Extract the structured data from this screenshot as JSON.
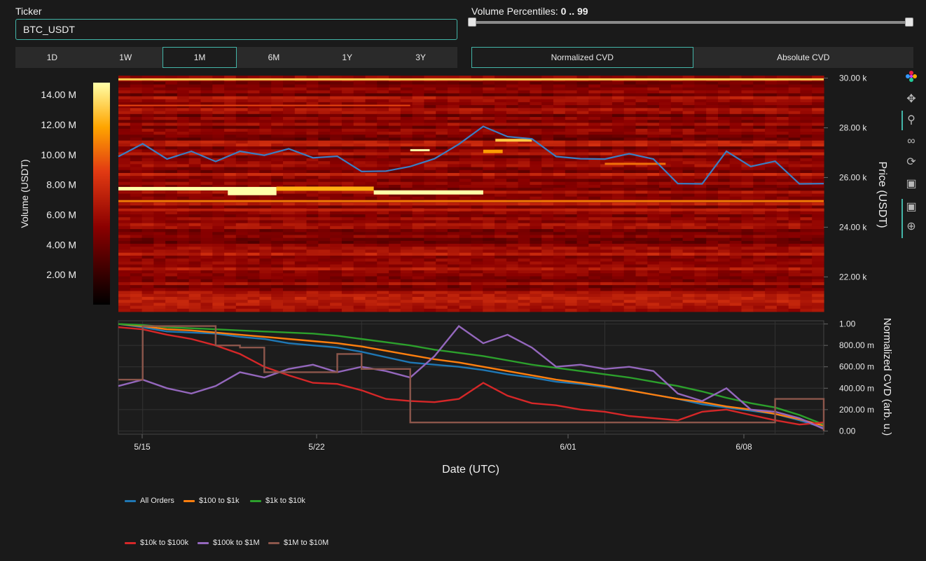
{
  "ticker": {
    "label": "Ticker",
    "value": "BTC_USDT"
  },
  "volume_percentiles": {
    "label": "Volume Percentiles:",
    "range_text": "0 .. 99",
    "min": 0,
    "max": 99
  },
  "range_buttons": [
    {
      "label": "1D",
      "active": false
    },
    {
      "label": "1W",
      "active": false
    },
    {
      "label": "1M",
      "active": true
    },
    {
      "label": "6M",
      "active": false
    },
    {
      "label": "1Y",
      "active": false
    },
    {
      "label": "3Y",
      "active": false
    }
  ],
  "cvd_buttons": [
    {
      "label": "Normalized CVD",
      "active": true
    },
    {
      "label": "Absolute CVD",
      "active": false
    }
  ],
  "modebar_icons": [
    "plotly-logo-icon",
    "pan-icon",
    "zoom-icon",
    "lasso-icon",
    "reset-icon",
    "download-icon",
    "comment-icon",
    "crosshair-icon"
  ],
  "chart_data": [
    {
      "type": "heatmap",
      "xlabel": "",
      "ylabel": "Price (USDT)",
      "y_ticks": [
        "22.00 k",
        "24.00 k",
        "26.00 k",
        "28.00 k",
        "30.00 k"
      ],
      "y_tick_values": [
        22000,
        24000,
        26000,
        28000,
        30000
      ],
      "ylim": [
        20600,
        30100
      ],
      "colorbar": {
        "label": "Volume (USDT)",
        "ticks": [
          "2.00 M",
          "4.00 M",
          "6.00 M",
          "8.00 M",
          "10.00 M",
          "12.00 M",
          "14.00 M"
        ],
        "range": [
          0,
          14800000
        ]
      },
      "price_line": {
        "name": "Price",
        "x_days": [
          0,
          1,
          2,
          3,
          4,
          5,
          6,
          7,
          8,
          9,
          10,
          11,
          12,
          13,
          14,
          15,
          16,
          17,
          18,
          19,
          20,
          21,
          22,
          23,
          24,
          25,
          26,
          27,
          28,
          29
        ],
        "values": [
          26900,
          27300,
          26800,
          27000,
          26700,
          27000,
          26950,
          27100,
          26850,
          26800,
          26300,
          26200,
          26500,
          26700,
          27400,
          28000,
          27700,
          27500,
          26900,
          26700,
          26800,
          26900,
          26800,
          25700,
          25800,
          27000,
          26500,
          26600,
          25800,
          25700
        ]
      }
    },
    {
      "type": "line",
      "xlabel": "Date (UTC)",
      "ylabel": "Normalized CVD (arb. u.)",
      "x_ticks": [
        "5/15",
        "5/22",
        "6/01",
        "6/08"
      ],
      "y_ticks": [
        "0.00",
        "200.00 m",
        "400.00 m",
        "600.00 m",
        "800.00 m",
        "1.00"
      ],
      "y_tick_values": [
        0,
        0.2,
        0.4,
        0.6,
        0.8,
        1.0
      ],
      "ylim": [
        -0.03,
        1.03
      ],
      "x_days": [
        0,
        1,
        2,
        3,
        4,
        5,
        6,
        7,
        8,
        9,
        10,
        11,
        12,
        13,
        14,
        15,
        16,
        17,
        18,
        19,
        20,
        21,
        22,
        23,
        24,
        25,
        26,
        27,
        28,
        29
      ],
      "series": [
        {
          "name": "All Orders",
          "color": "#1f77b4",
          "values": [
            1.0,
            0.97,
            0.93,
            0.92,
            0.91,
            0.88,
            0.86,
            0.82,
            0.8,
            0.78,
            0.74,
            0.69,
            0.64,
            0.62,
            0.6,
            0.57,
            0.53,
            0.5,
            0.46,
            0.44,
            0.41,
            0.38,
            0.34,
            0.3,
            0.25,
            0.22,
            0.19,
            0.16,
            0.1,
            0.03
          ]
        },
        {
          "name": "$100 to $1k",
          "color": "#ff7f0e",
          "values": [
            1.0,
            0.98,
            0.95,
            0.94,
            0.92,
            0.9,
            0.88,
            0.86,
            0.84,
            0.82,
            0.79,
            0.75,
            0.71,
            0.67,
            0.64,
            0.6,
            0.56,
            0.52,
            0.48,
            0.45,
            0.42,
            0.38,
            0.34,
            0.3,
            0.27,
            0.23,
            0.2,
            0.16,
            0.11,
            0.05
          ]
        },
        {
          "name": "$1k to $10k",
          "color": "#2ca02c",
          "values": [
            1.0,
            0.99,
            0.97,
            0.96,
            0.95,
            0.94,
            0.93,
            0.92,
            0.91,
            0.89,
            0.86,
            0.83,
            0.8,
            0.76,
            0.73,
            0.7,
            0.66,
            0.62,
            0.59,
            0.56,
            0.53,
            0.5,
            0.46,
            0.42,
            0.37,
            0.31,
            0.26,
            0.22,
            0.15,
            0.06
          ]
        },
        {
          "name": "$10k to $100k",
          "color": "#d62728",
          "values": [
            0.97,
            0.95,
            0.9,
            0.86,
            0.8,
            0.72,
            0.6,
            0.52,
            0.45,
            0.44,
            0.38,
            0.3,
            0.28,
            0.27,
            0.3,
            0.45,
            0.33,
            0.26,
            0.24,
            0.2,
            0.18,
            0.14,
            0.12,
            0.1,
            0.18,
            0.2,
            0.15,
            0.1,
            0.06,
            0.08
          ]
        },
        {
          "name": "$100k to $1M",
          "color": "#9467bd",
          "values": [
            0.42,
            0.48,
            0.4,
            0.35,
            0.42,
            0.55,
            0.5,
            0.58,
            0.62,
            0.55,
            0.6,
            0.56,
            0.5,
            0.7,
            0.98,
            0.82,
            0.9,
            0.78,
            0.6,
            0.62,
            0.58,
            0.6,
            0.56,
            0.35,
            0.28,
            0.4,
            0.2,
            0.18,
            0.12,
            0.02
          ]
        },
        {
          "name": "$1M to $10M",
          "color": "#8c564b",
          "values": [
            0.48,
            0.98,
            0.98,
            0.98,
            0.8,
            0.78,
            0.55,
            0.55,
            0.55,
            0.72,
            0.58,
            0.58,
            0.08,
            0.08,
            0.08,
            0.08,
            0.08,
            0.08,
            0.08,
            0.08,
            0.08,
            0.08,
            0.08,
            0.08,
            0.08,
            0.08,
            0.08,
            0.3,
            0.3,
            0.0
          ]
        }
      ]
    }
  ]
}
